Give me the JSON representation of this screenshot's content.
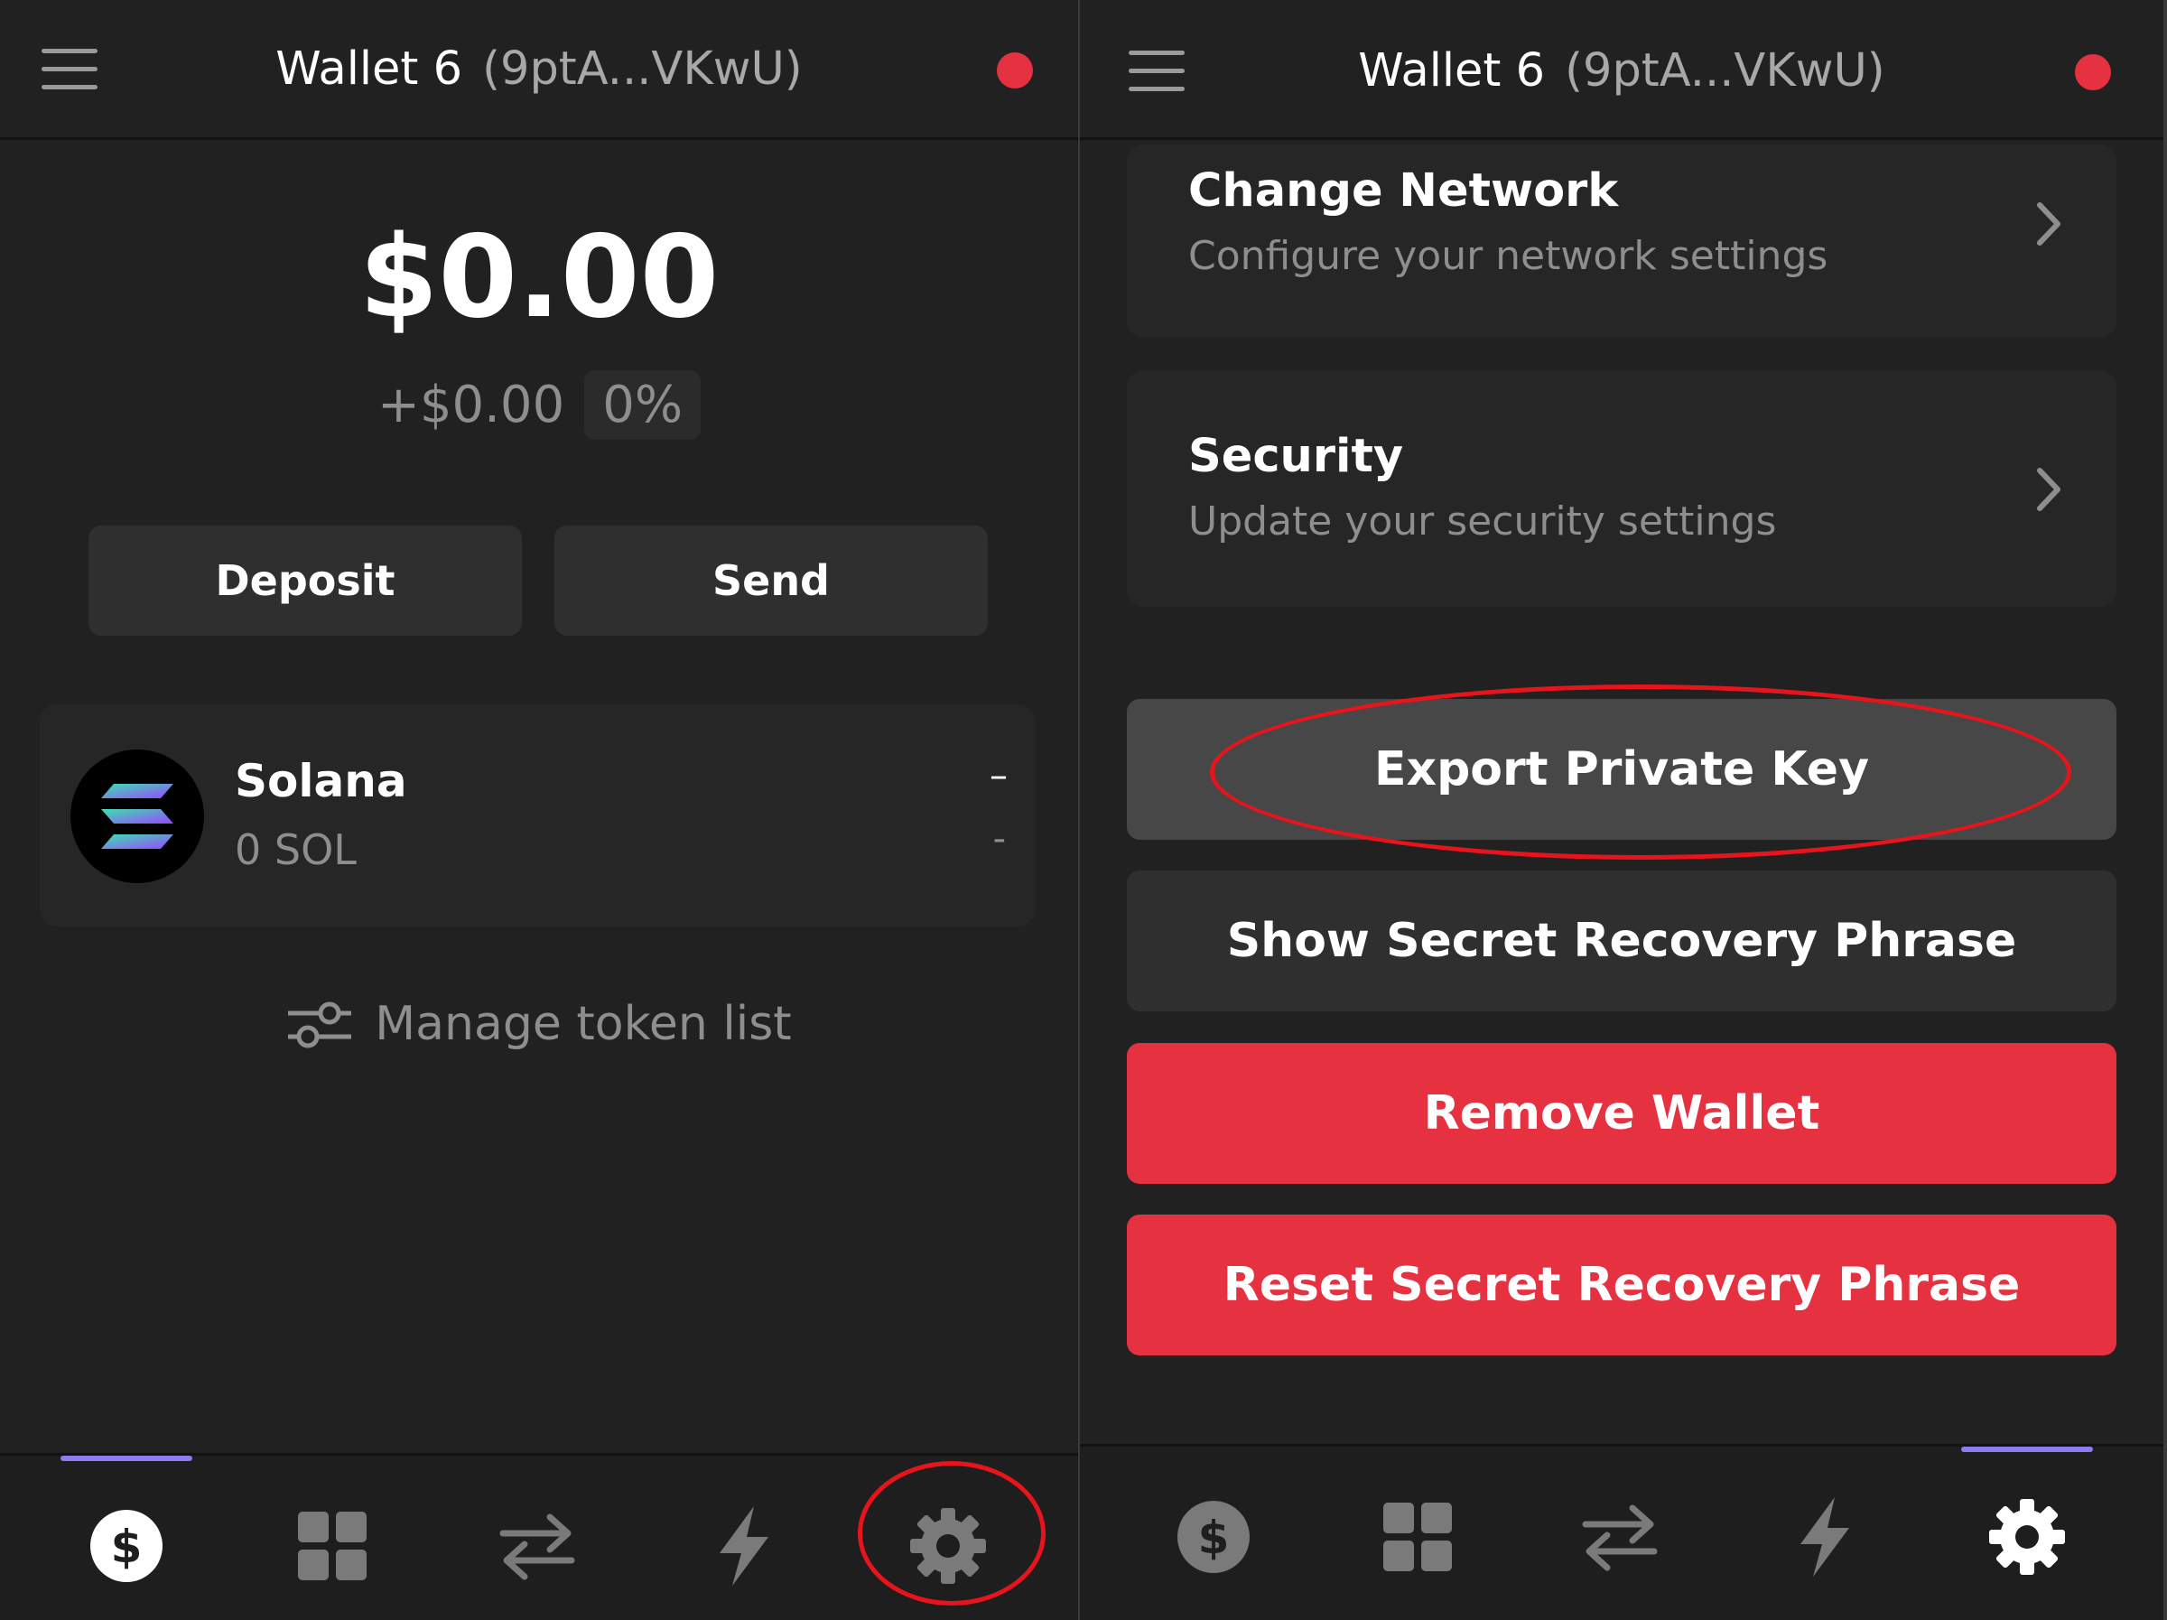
{
  "header": {
    "wallet_name": "Wallet 6",
    "wallet_address": "(9ptA...VKwU)",
    "status_color": "#e63141"
  },
  "wallet": {
    "balance": "$0.00",
    "change_amount": "+$0.00",
    "change_percent": "0%",
    "deposit_label": "Deposit",
    "send_label": "Send"
  },
  "tokens": [
    {
      "name": "Solana",
      "amount": "0 SOL",
      "value": "–",
      "change": "-"
    }
  ],
  "manage_tokens_label": "Manage token list",
  "settings": {
    "items": [
      {
        "title": "Change Network",
        "subtitle": "Configure your network settings"
      },
      {
        "title": "Security",
        "subtitle": "Update your security settings"
      }
    ],
    "actions": {
      "export_private_key": "Export Private Key",
      "show_recovery_phrase": "Show Secret Recovery Phrase",
      "remove_wallet": "Remove Wallet",
      "reset_recovery_phrase": "Reset Secret Recovery Phrase"
    }
  },
  "tabbar": {
    "tabs": [
      "balances-icon",
      "apps-grid-icon",
      "swap-icon",
      "activity-bolt-icon",
      "settings-gear-icon"
    ],
    "accent_color": "#8b7cf0"
  },
  "annotations": {
    "highlight_color": "#e8141c"
  }
}
